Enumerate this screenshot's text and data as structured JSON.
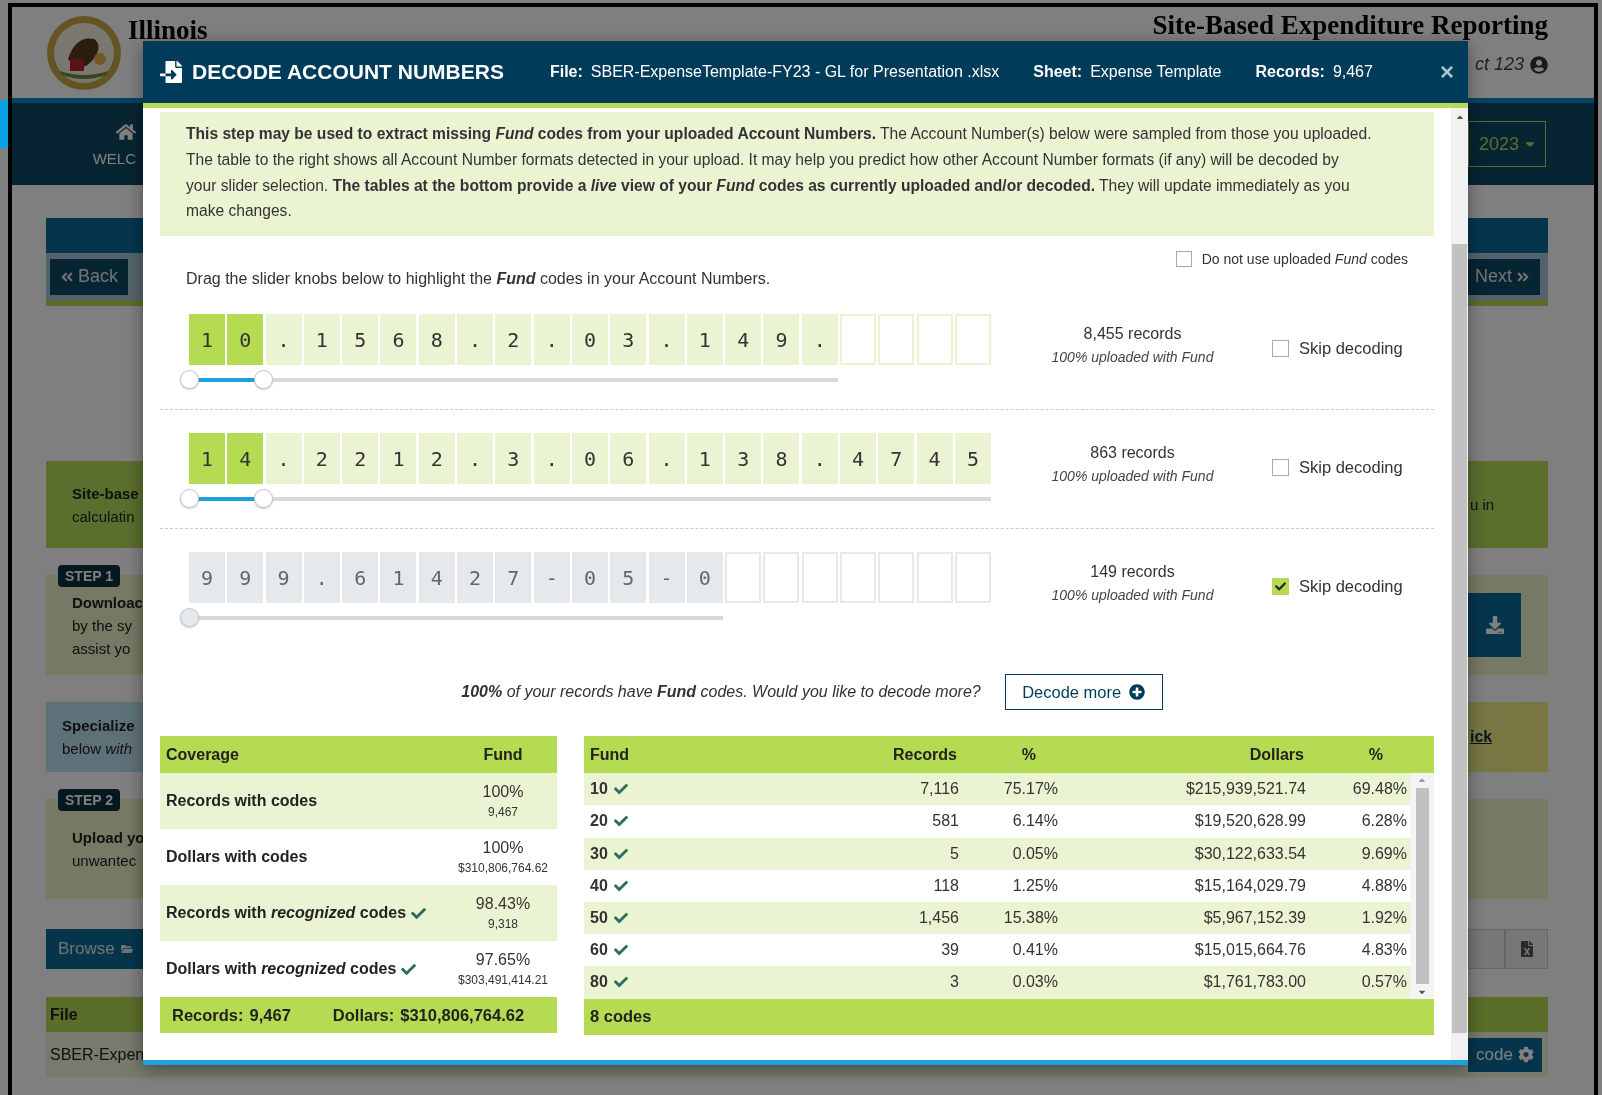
{
  "background_page": {
    "site_name": "Illinois",
    "app_title": "Site-Based Expenditure Reporting",
    "user": "ct 123",
    "nav_item": "WELC",
    "year_button": "2023",
    "back_button": "Back",
    "next_button": "Next",
    "panels": [
      {
        "kind": "note",
        "lines": [
          "Site-base",
          "calculatin"
        ],
        "right_text": "u in"
      },
      {
        "kind": "step",
        "badge": "STEP 1",
        "lines": [
          "Downloac",
          "by the sy",
          "assist yo"
        ]
      },
      {
        "kind": "special",
        "lines": [
          "Specialize",
          "below *with*"
        ],
        "right_link": "ick"
      },
      {
        "kind": "step",
        "badge": "STEP 2",
        "lines": [
          "Upload yo",
          "unwantec"
        ]
      }
    ],
    "browse_button": "Browse",
    "file_column": "File",
    "file_row": "SBER-Expen",
    "decode_button": "code"
  },
  "modal": {
    "title": "DECODE ACCOUNT NUMBERS",
    "file_label": "File:",
    "file": "SBER-ExpenseTemplate-FY23 - GL for Presentation .xlsx",
    "sheet_label": "Sheet:",
    "sheet": "Expense Template",
    "records_label": "Records:",
    "records": "9,467",
    "close": "×",
    "intro": "**This step may be used to extract missing *Fund* codes from your uploaded Account Numbers.** The Account Number(s) below were sampled from those you uploaded. The table to the right shows all Account Number formats detected in your upload. It may help you predict how other Account Number formats (if any) will be decoded by your slider selection. **The tables at the bottom provide a *live* view of your *Fund* codes as currently uploaded and/or decoded.** They will update immediately as you make changes.",
    "no_uploaded": {
      "label": "Do not use uploaded *Fund* codes",
      "checked": false
    },
    "instruction": "Drag the slider knobs below to highlight the **Fund** codes in your Account Numbers.",
    "accounts": [
      {
        "cells": [
          {
            "kind": "char",
            "char": "1",
            "selected": true
          },
          {
            "kind": "char",
            "char": "0",
            "selected": true
          },
          {
            "kind": "char",
            "char": ".",
            "selected": false
          },
          {
            "kind": "char",
            "char": "1",
            "selected": false
          },
          {
            "kind": "char",
            "char": "5",
            "selected": false
          },
          {
            "kind": "char",
            "char": "6",
            "selected": false
          },
          {
            "kind": "char",
            "char": "8",
            "selected": false
          },
          {
            "kind": "char",
            "char": ".",
            "selected": false
          },
          {
            "kind": "char",
            "char": "2",
            "selected": false
          },
          {
            "kind": "char",
            "char": ".",
            "selected": false
          },
          {
            "kind": "char",
            "char": "0",
            "selected": false
          },
          {
            "kind": "char",
            "char": "3",
            "selected": false
          },
          {
            "kind": "char",
            "char": ".",
            "selected": false
          },
          {
            "kind": "char",
            "char": "1",
            "selected": false
          },
          {
            "kind": "char",
            "char": "4",
            "selected": false
          },
          {
            "kind": "char",
            "char": "9",
            "selected": false
          },
          {
            "kind": "char",
            "char": ".",
            "selected": false
          },
          {
            "kind": "blank",
            "selected": false
          },
          {
            "kind": "blank",
            "selected": false
          },
          {
            "kind": "blank",
            "selected": false
          },
          {
            "kind": "blank",
            "selected": false
          }
        ],
        "records": "8,455 records",
        "uploaded": "100% uploaded with Fund",
        "skip": {
          "label": "Skip decoding",
          "checked": false
        }
      },
      {
        "cells": [
          {
            "kind": "char",
            "char": "1",
            "selected": true
          },
          {
            "kind": "char",
            "char": "4",
            "selected": true
          },
          {
            "kind": "char",
            "char": ".",
            "selected": false
          },
          {
            "kind": "char",
            "char": "2",
            "selected": false
          },
          {
            "kind": "char",
            "char": "2",
            "selected": false
          },
          {
            "kind": "char",
            "char": "1",
            "selected": false
          },
          {
            "kind": "char",
            "char": "2",
            "selected": false
          },
          {
            "kind": "char",
            "char": ".",
            "selected": false
          },
          {
            "kind": "char",
            "char": "3",
            "selected": false
          },
          {
            "kind": "char",
            "char": ".",
            "selected": false
          },
          {
            "kind": "char",
            "char": "0",
            "selected": false
          },
          {
            "kind": "char",
            "char": "6",
            "selected": false
          },
          {
            "kind": "char",
            "char": ".",
            "selected": false
          },
          {
            "kind": "char",
            "char": "1",
            "selected": false
          },
          {
            "kind": "char",
            "char": "3",
            "selected": false
          },
          {
            "kind": "char",
            "char": "8",
            "selected": false
          },
          {
            "kind": "char",
            "char": ".",
            "selected": false
          },
          {
            "kind": "char",
            "char": "4",
            "selected": false
          },
          {
            "kind": "char",
            "char": "7",
            "selected": false
          },
          {
            "kind": "char",
            "char": "4",
            "selected": false
          },
          {
            "kind": "char",
            "char": "5",
            "selected": false
          }
        ],
        "records": "863 records",
        "uploaded": "100% uploaded with Fund",
        "skip": {
          "label": "Skip decoding",
          "checked": false
        }
      },
      {
        "cells": [
          {
            "kind": "char",
            "char": "9",
            "selected": false
          },
          {
            "kind": "char",
            "char": "9",
            "selected": false
          },
          {
            "kind": "char",
            "char": "9",
            "selected": false
          },
          {
            "kind": "char",
            "char": ".",
            "selected": false
          },
          {
            "kind": "char",
            "char": "6",
            "selected": false
          },
          {
            "kind": "char",
            "char": "1",
            "selected": false
          },
          {
            "kind": "char",
            "char": "4",
            "selected": false
          },
          {
            "kind": "char",
            "char": "2",
            "selected": false
          },
          {
            "kind": "char",
            "char": "7",
            "selected": false
          },
          {
            "kind": "char",
            "char": "-",
            "selected": false
          },
          {
            "kind": "char",
            "char": "0",
            "selected": false
          },
          {
            "kind": "char",
            "char": "5",
            "selected": false
          },
          {
            "kind": "char",
            "char": "-",
            "selected": false
          },
          {
            "kind": "char",
            "char": "0",
            "selected": false
          },
          {
            "kind": "blank",
            "selected": false
          },
          {
            "kind": "blank",
            "selected": false
          },
          {
            "kind": "blank",
            "selected": false
          },
          {
            "kind": "blank",
            "selected": false
          },
          {
            "kind": "blank",
            "selected": false
          },
          {
            "kind": "blank",
            "selected": false
          },
          {
            "kind": "blank",
            "selected": false
          }
        ],
        "records": "149 records",
        "uploaded": "100% uploaded with Fund",
        "skip": {
          "label": "Skip decoding",
          "checked": true
        }
      }
    ],
    "decode_prompt": "**100%** of your records have **Fund** codes. Would you like to decode more?",
    "decode_button": "Decode more",
    "coverage_table": {
      "columns": [
        "Coverage",
        "Fund"
      ],
      "rows": [
        {
          "label": "Records with codes",
          "recognized": false,
          "percent": "100%",
          "amount": "9,467"
        },
        {
          "label": "Dollars with codes",
          "recognized": false,
          "percent": "100%",
          "amount": "$310,806,764.62"
        },
        {
          "label": "Records with *recognized* codes",
          "recognized": true,
          "percent": "98.43%",
          "amount": "9,318"
        },
        {
          "label": "Dollars with *recognized* codes",
          "recognized": true,
          "percent": "97.65%",
          "amount": "$303,491,414.21"
        }
      ],
      "footer": {
        "records_label": "Records:",
        "records": "9,467",
        "dollars_label": "Dollars:",
        "dollars": "$310,806,764.62"
      }
    },
    "fund_table": {
      "columns": [
        "Fund",
        "Records",
        "%",
        "Dollars",
        "%"
      ],
      "rows": [
        {
          "fund": "10",
          "recognized": true,
          "records": "7,116",
          "records_pct": "75.17%",
          "dollars": "$215,939,521.74",
          "dollars_pct": "69.48%"
        },
        {
          "fund": "20",
          "recognized": true,
          "records": "581",
          "records_pct": "6.14%",
          "dollars": "$19,520,628.99",
          "dollars_pct": "6.28%"
        },
        {
          "fund": "30",
          "recognized": true,
          "records": "5",
          "records_pct": "0.05%",
          "dollars": "$30,122,633.54",
          "dollars_pct": "9.69%"
        },
        {
          "fund": "40",
          "recognized": true,
          "records": "118",
          "records_pct": "1.25%",
          "dollars": "$15,164,029.79",
          "dollars_pct": "4.88%"
        },
        {
          "fund": "50",
          "recognized": true,
          "records": "1,456",
          "records_pct": "15.38%",
          "dollars": "$5,967,152.39",
          "dollars_pct": "1.92%"
        },
        {
          "fund": "60",
          "recognized": true,
          "records": "39",
          "records_pct": "0.41%",
          "dollars": "$15,015,664.76",
          "dollars_pct": "4.83%"
        },
        {
          "fund": "80",
          "recognized": true,
          "records": "3",
          "records_pct": "0.03%",
          "dollars": "$1,761,783.00",
          "dollars_pct": "0.57%"
        }
      ],
      "footer": "8 codes"
    }
  }
}
